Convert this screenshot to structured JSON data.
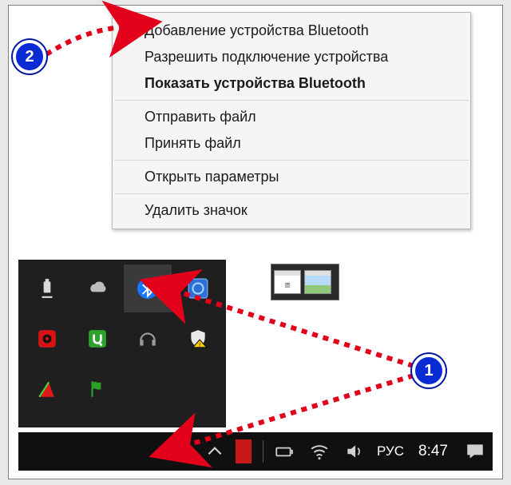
{
  "menu": {
    "items": [
      "Добавление устройства Bluetooth",
      "Разрешить подключение устройства",
      "Показать устройства Bluetooth",
      "Отправить файл",
      "Принять файл",
      "Открыть параметры",
      "Удалить значок"
    ],
    "bold_index": 2,
    "separators_after": [
      2,
      4,
      5
    ]
  },
  "tray_icons": [
    "usb-eject-icon",
    "onedrive-icon",
    "bluetooth-icon",
    "intel-graphics-icon",
    "bandicam-icon",
    "utorrent-icon",
    "headset-icon",
    "security-alert-icon",
    "red-triangle-icon",
    "flag-icon",
    "",
    ""
  ],
  "taskbar": {
    "lang": "РУС",
    "clock": "8:47"
  },
  "callouts": {
    "one": "1",
    "two": "2"
  }
}
